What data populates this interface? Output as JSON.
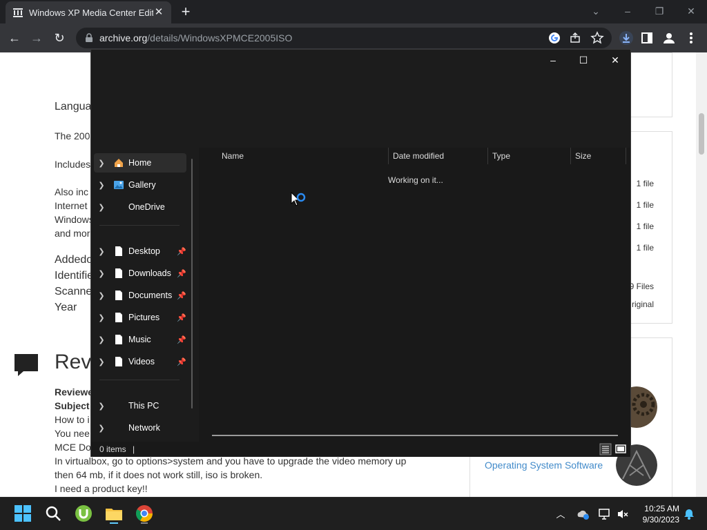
{
  "browser": {
    "tab_title": "Windows XP Media Center Editio",
    "url_host": "archive.org",
    "url_path": "/details/WindowsXPMCE2005ISO",
    "accent": "#8ab4f8"
  },
  "page": {
    "lines": [
      {
        "text": "Langua",
        "big": true
      },
      {
        "text": "The 200"
      },
      {
        "text": "Includes"
      },
      {
        "text": "Also inc"
      },
      {
        "text": "Internet"
      },
      {
        "text": "Windows"
      },
      {
        "text": "and mor"
      },
      {
        "text": "Addedo",
        "big": true
      },
      {
        "text": "Identifie",
        "big": true
      },
      {
        "text": "Scanne",
        "big": true
      },
      {
        "text": "Year",
        "big": true
      }
    ],
    "reviews_title": "Rev",
    "review_lines": [
      "Reviewe",
      "Subject",
      "How to i",
      "You nee",
      "MCE Do",
      "In virtualbox, go to options>system and you have to upgrade the video memory up",
      "then 64 mb, if it does not work still, iso is broken.",
      "I need a product key!!"
    ],
    "file_counts": [
      "1 file",
      "1 file",
      "1 file",
      "1 file"
    ],
    "files_total": "9 Files",
    "original": "riginal",
    "os_link": "Operating System Software"
  },
  "explorer": {
    "nav": [
      {
        "label": "Home",
        "icon": "home-icon",
        "active": true,
        "pinned": false
      },
      {
        "label": "Gallery",
        "icon": "gallery-icon",
        "pinned": false
      },
      {
        "label": "OneDrive",
        "icon": "",
        "pinned": false
      },
      {
        "label": "Desktop",
        "icon": "document-icon",
        "pinned": true
      },
      {
        "label": "Downloads",
        "icon": "document-icon",
        "pinned": true
      },
      {
        "label": "Documents",
        "icon": "document-icon",
        "pinned": true
      },
      {
        "label": "Pictures",
        "icon": "document-icon",
        "pinned": true
      },
      {
        "label": "Music",
        "icon": "document-icon",
        "pinned": true
      },
      {
        "label": "Videos",
        "icon": "document-icon",
        "pinned": true
      },
      {
        "label": "This PC",
        "icon": "",
        "pinned": false
      },
      {
        "label": "Network",
        "icon": "",
        "pinned": false
      }
    ],
    "columns": [
      "Name",
      "Date modified",
      "Type",
      "Size"
    ],
    "status_message": "Working on it...",
    "items_count": "0 items",
    "status_cursor": "|"
  },
  "taskbar": {
    "time": "10:25 AM",
    "date": "9/30/2023"
  }
}
